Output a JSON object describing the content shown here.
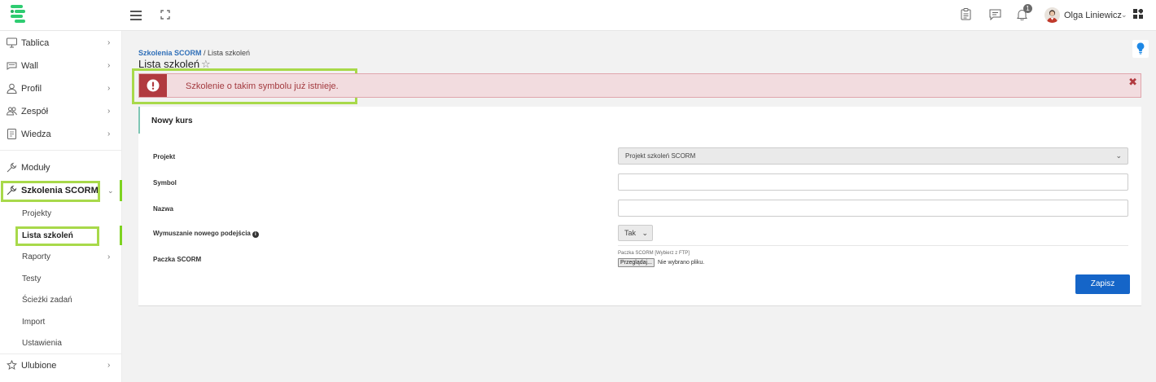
{
  "header": {
    "user_name": "Olga Liniewicz",
    "notification_count": "1",
    "icons": [
      "hamburger-icon",
      "fullscreen-icon",
      "clipboard-icon",
      "chat-icon",
      "bell-icon",
      "apps-grid-icon"
    ]
  },
  "sidebar": {
    "items": [
      {
        "label": "Tablica",
        "icon": "monitor-icon"
      },
      {
        "label": "Wall",
        "icon": "wall-icon"
      },
      {
        "label": "Profil",
        "icon": "user-icon"
      },
      {
        "label": "Zespół",
        "icon": "team-icon"
      },
      {
        "label": "Wiedza",
        "icon": "book-icon"
      },
      {
        "label": "Moduły",
        "icon": "wrench-icon"
      },
      {
        "label": "Szkolenia SCORM",
        "icon": "wrench-icon"
      }
    ],
    "subitems": [
      "Projekty",
      "Lista szkoleń",
      "Raporty",
      "Testy",
      "Ścieżki zadań",
      "Import",
      "Ustawienia"
    ],
    "favorites_label": "Ulubione"
  },
  "breadcrumb": {
    "link": "Szkolenia SCORM",
    "separator": " / ",
    "current": "Lista szkoleń"
  },
  "page_title": "Lista szkoleń",
  "alert": {
    "message": "Szkolenie o takim symbolu już istnieje.",
    "color": "#b13a3f"
  },
  "form": {
    "title": "Nowy kurs",
    "labels": {
      "project": "Projekt",
      "symbol": "Symbol",
      "name": "Nazwa",
      "force_attempt": "Wymuszanie nowego podejścia",
      "package": "Paczka SCORM"
    },
    "project_value": "Projekt szkoleń SCORM",
    "force_attempt_value": "Tak",
    "package_hint": "Paczka SCORM [Wybierz z FTP]",
    "browse_label": "Przeglądaj...",
    "no_file": "Nie wybrano pliku.",
    "save_label": "Zapisz"
  },
  "colors": {
    "accent": "#1565c8",
    "highlight": "#a8d94a",
    "active_bar": "#7ed321"
  }
}
